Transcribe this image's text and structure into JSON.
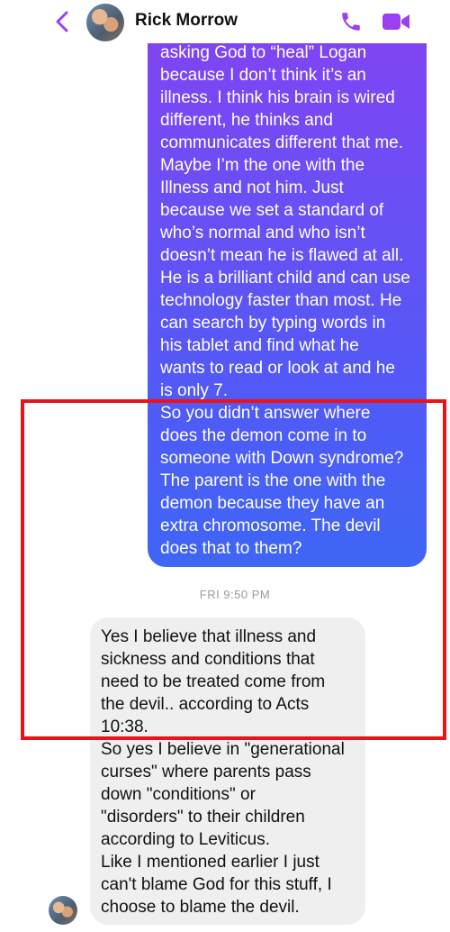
{
  "header": {
    "contact_name": "Rick Morrow",
    "back_icon": "chevron-left-icon",
    "call_icon": "phone-icon",
    "video_icon": "video-camera-icon",
    "accent_color": "#9b3ff0"
  },
  "messages": {
    "sent_text": "asking God to “heal” Logan\nbecause I don’t think it’s an\nillness. I think his brain is wired\ndifferent, he thinks and\ncommunicates different that me.\nMaybe I’m the one with the\nIllness and not him. Just\nbecause we set a standard of\nwho’s normal and who isn’t\ndoesn’t mean he is flawed at all.\nHe is a brilliant child and can use\ntechnology faster than most. He\ncan search by typing words in\nhis tablet and find what he\nwants to read or look at and he\nis only 7.\nSo you didn’t answer where\ndoes the demon come in to\nsomeone with Down syndrome?\nThe parent is the one with the\ndemon because they have an\nextra chromosome. The devil\ndoes that to them?",
    "timestamp": "FRI 9:50 PM",
    "received_text": "Yes I believe that illness and\nsickness and conditions that\nneed to be treated come from\nthe devil.. according to Acts\n10:38.\nSo yes I believe in \"generational\ncurses\" where parents pass\ndown \"conditions\" or\n\"disorders\" to their children\naccording to Leviticus.\nLike I mentioned earlier I just\ncan't blame God for this stuff, I\nchoose to blame the devil."
  },
  "annotation": {
    "highlight_color": "#e8141c"
  }
}
